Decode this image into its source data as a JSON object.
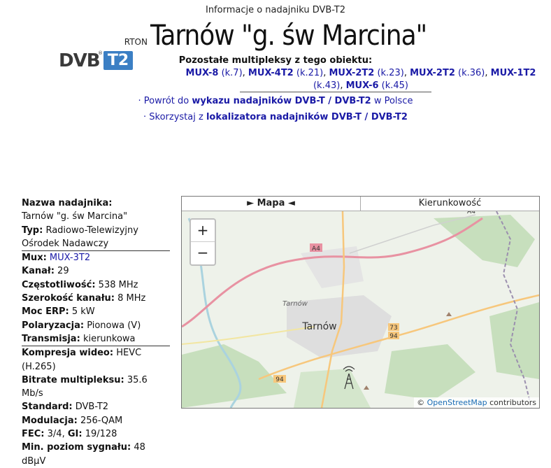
{
  "header": {
    "subtitle": "Informacje o nadajniku DVB-T2",
    "prefix": "RTON",
    "title": "Tarnów \"g. św Marcina\"",
    "logo": {
      "dvb": "DVB",
      "t2": "T2",
      "reg": "®"
    },
    "other_heading": "Pozostałe multipleksy z tego obiektu:",
    "other_muxes": [
      {
        "name": "MUX-8",
        "channel": "(k.7)"
      },
      {
        "name": "MUX-4T2",
        "channel": "(k.21)"
      },
      {
        "name": "MUX-2T2",
        "channel": "(k.23)"
      },
      {
        "name": "MUX-2T2",
        "channel": "(k.36)"
      },
      {
        "name": "MUX-1T2",
        "channel": "(k.43)"
      },
      {
        "name": "MUX-6",
        "channel": "(k.45)"
      }
    ],
    "nav1": {
      "pre": "· Powrót do ",
      "link": "wykazu nadajników DVB-T / DVB-T2",
      "post": " w Polsce"
    },
    "nav2": {
      "pre": "· Skorzystaj z ",
      "link": "lokalizatora nadajników DVB-T / DVB-T2",
      "post": ""
    }
  },
  "info": {
    "name_label": "Nazwa nadajnika:",
    "name_value": "Tarnów \"g. św Marcina\"",
    "type_label": "Typ:",
    "type_value": "Radiowo-Telewizyjny Ośrodek Nadawczy",
    "mux_label": "Mux:",
    "mux_value": "MUX-3T2",
    "channel_label": "Kanał:",
    "channel_value": "29",
    "freq_label": "Częstotliwość:",
    "freq_value": "538 MHz",
    "width_label": "Szerokość kanału:",
    "width_value": "8 MHz",
    "erp_label": "Moc ERP:",
    "erp_value": "5 kW",
    "pol_label": "Polaryzacja:",
    "pol_value": "Pionowa (V)",
    "tx_label": "Transmisja:",
    "tx_value": "kierunkowa",
    "comp_label": "Kompresja wideo:",
    "comp_value": "HEVC (H.265)",
    "bitrate_label": "Bitrate multipleksu:",
    "bitrate_value": "35.6 Mb/s",
    "std_label": "Standard:",
    "std_value": "DVB-T2",
    "mod_label": "Modulacja:",
    "mod_value": "256-QAM",
    "fec_label": "FEC:",
    "fec_value": "3/4,",
    "gi_label": "GI:",
    "gi_value": "19/128",
    "min_label": "Min. poziom sygnału:",
    "min_value": "48 dBµV"
  },
  "map": {
    "tab_map": "► Mapa ◄",
    "tab_dir": "Kierunkowość",
    "zoom_in": "+",
    "zoom_out": "−",
    "labels": {
      "city": "Tarnów",
      "city_small": "Tarnów",
      "a4_1": "A4",
      "a4_2": "A4",
      "r73": "73",
      "r94a": "94",
      "r94b": "94"
    },
    "attribution": {
      "pre": "© ",
      "link": "OpenStreetMap",
      "post": " contributors"
    },
    "colors": {
      "motorway": "#e892a2",
      "road": "#f7c77c",
      "forest": "#aed1a0",
      "land": "#eef2ea",
      "urban": "#dcdcdc"
    }
  }
}
